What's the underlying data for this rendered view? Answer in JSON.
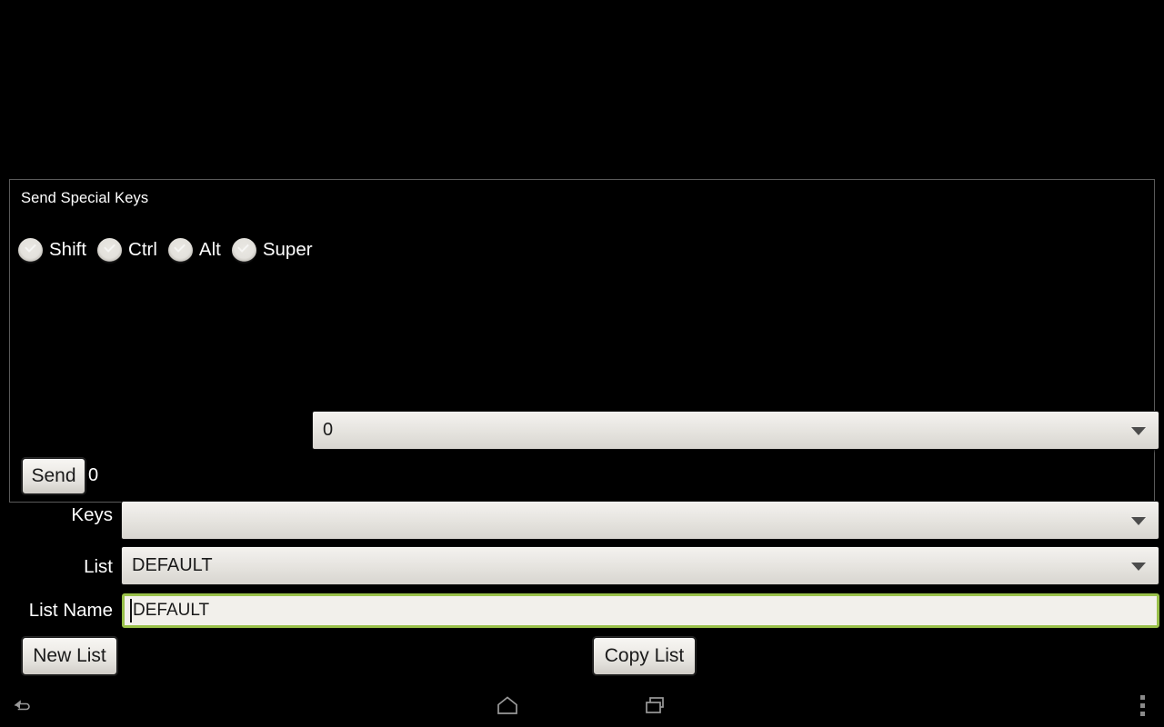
{
  "panel": {
    "title": "Send Special Keys"
  },
  "modifiers": [
    {
      "label": "Shift",
      "icon": "checkbox-unchecked-icon",
      "checked": false
    },
    {
      "label": "Ctrl",
      "icon": "checkbox-unchecked-icon",
      "checked": false
    },
    {
      "label": "Alt",
      "icon": "checkbox-unchecked-icon",
      "checked": false
    },
    {
      "label": "Super",
      "icon": "checkbox-unchecked-icon",
      "checked": false
    }
  ],
  "keycode_spinner": {
    "value": "0",
    "arrow_icon": "chevron-down-icon"
  },
  "send": {
    "button_label": "Send",
    "count": "0"
  },
  "rows": {
    "keys": {
      "label": "Keys",
      "value": "",
      "arrow_icon": "chevron-down-icon"
    },
    "list": {
      "label": "List",
      "value": "DEFAULT",
      "arrow_icon": "chevron-down-icon"
    },
    "list_name": {
      "label": "List Name",
      "value": "DEFAULT",
      "focused": true
    }
  },
  "actions": {
    "new_list_label": "New List",
    "copy_list_label": "Copy List"
  },
  "navbar": {
    "back_icon": "back-arrow-icon",
    "home_icon": "home-icon",
    "recents_icon": "recents-icon",
    "menu_icon": "overflow-menu-icon"
  },
  "colors": {
    "background": "#000000",
    "panel_border": "#5a5a5a",
    "text_primary": "#ffffff",
    "focus_accent": "#99c049",
    "control_face": "#e8e6e1",
    "control_text": "#1a1a1a"
  }
}
